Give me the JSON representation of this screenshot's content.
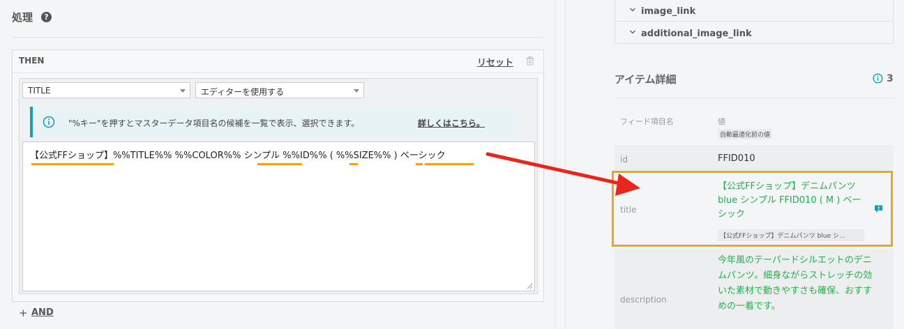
{
  "left": {
    "title": "処理",
    "then_label": "THEN",
    "reset_label": "リセット",
    "field_select": "TITLE",
    "mode_select": "エディターを使用する",
    "info_text": "\"%キー\"を押すとマスターデータ項目名の候補を一覧で表示、選択できます。",
    "info_link": "詳しくはこちら。",
    "editor_value": "【公式FFショップ】%%TITLE%% %%COLOR%% シンプル %%ID%% ( %%SIZE%% ) ベーシック",
    "and_label": "AND"
  },
  "right": {
    "link_rows": [
      "image_link",
      "additional_image_link"
    ],
    "detail_title": "アイテム詳細",
    "detail_count": "3",
    "col_field": "フィード項目名",
    "col_value": "値",
    "col_subtitle": "自動最適化前の値",
    "rows": {
      "id": {
        "key": "id",
        "value": "FFID010"
      },
      "title": {
        "key": "title",
        "value": "【公式FFショップ】デニムパンツ blue シンプル FFID010 ( M ) ベーシック",
        "original": "【公式FFショップ】デニムパンツ blue シ..."
      },
      "description": {
        "key": "description",
        "value": "今年風のテーパードシルエットのデニムパンツ。細身ながらストレッチの効いた素材で動きやすさも確保、おすすめの一着です。"
      }
    }
  },
  "colors": {
    "highlight": "#f5a21b",
    "optimized_text": "#23b04a",
    "arrow": "#e8261c",
    "info_accent": "#1f9bb0"
  }
}
